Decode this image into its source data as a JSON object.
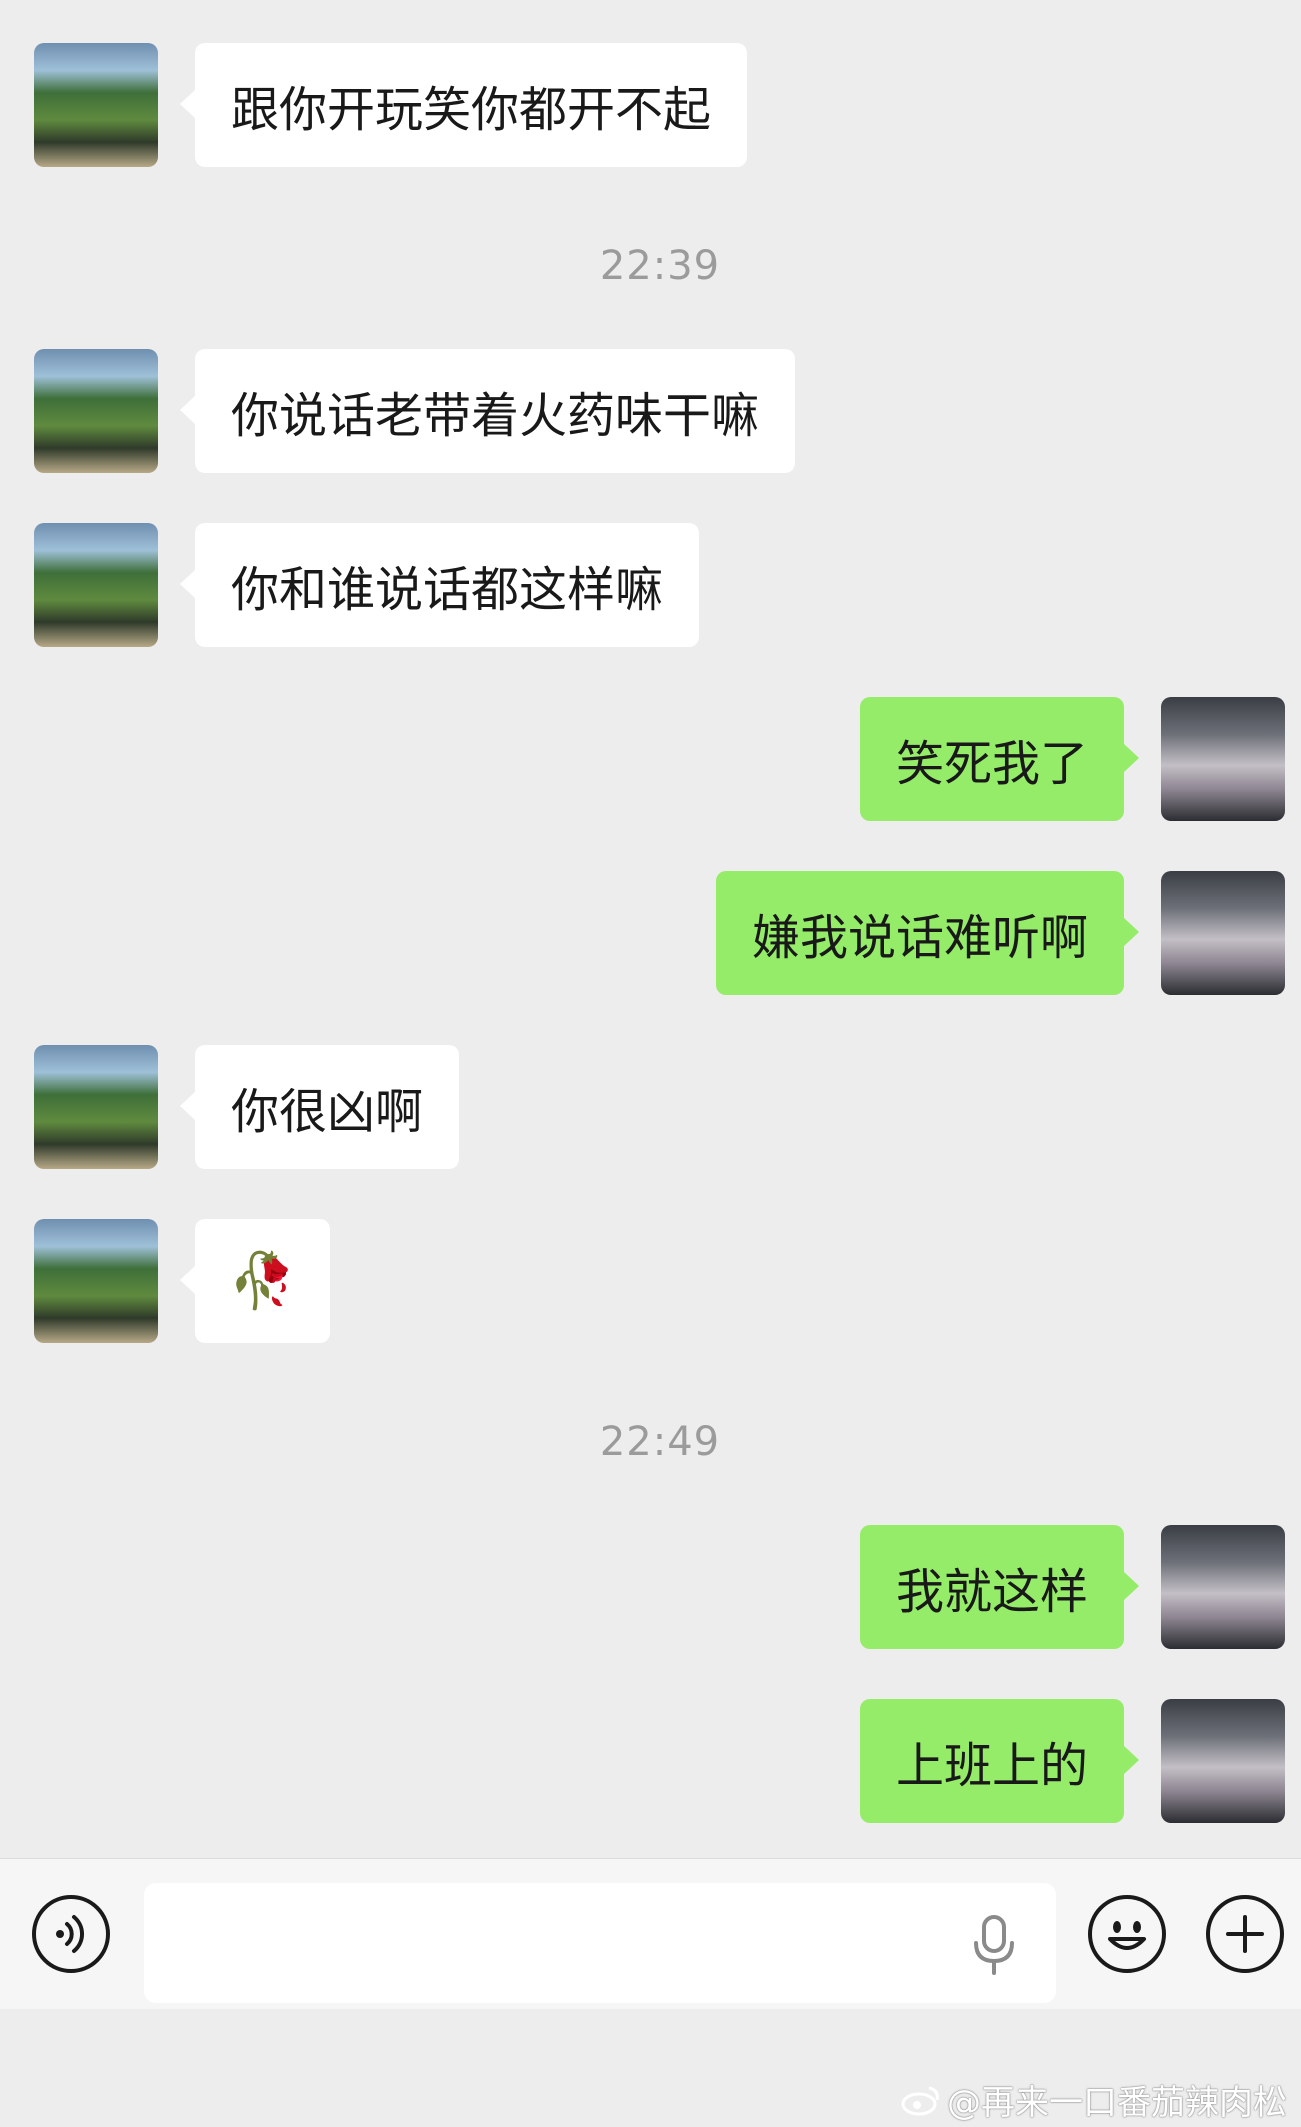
{
  "messages": [
    {
      "side": "left",
      "text": "跟你开玩笑你都开不起"
    },
    {
      "type": "time",
      "text": "22:39"
    },
    {
      "side": "left",
      "text": "你说话老带着火药味干嘛"
    },
    {
      "side": "left",
      "text": "你和谁说话都这样嘛"
    },
    {
      "side": "right",
      "text": "笑死我了"
    },
    {
      "side": "right",
      "text": "嫌我说话难听啊"
    },
    {
      "side": "left",
      "text": "你很凶啊"
    },
    {
      "side": "left",
      "text": "🥀"
    },
    {
      "type": "time",
      "text": "22:49"
    },
    {
      "side": "right",
      "text": "我就这样"
    },
    {
      "side": "right",
      "text": "上班上的"
    }
  ],
  "toolbar": {
    "voice_icon": "voice-mode-icon",
    "mic_icon": "microphone-icon",
    "emoji_icon": "emoji-icon",
    "plus_icon": "plus-icon"
  },
  "watermark": {
    "text": "@再来一口番茄辣肉松"
  },
  "colors": {
    "bubble_self": "#95ec69",
    "bubble_other": "#ffffff",
    "background": "#ededed"
  }
}
